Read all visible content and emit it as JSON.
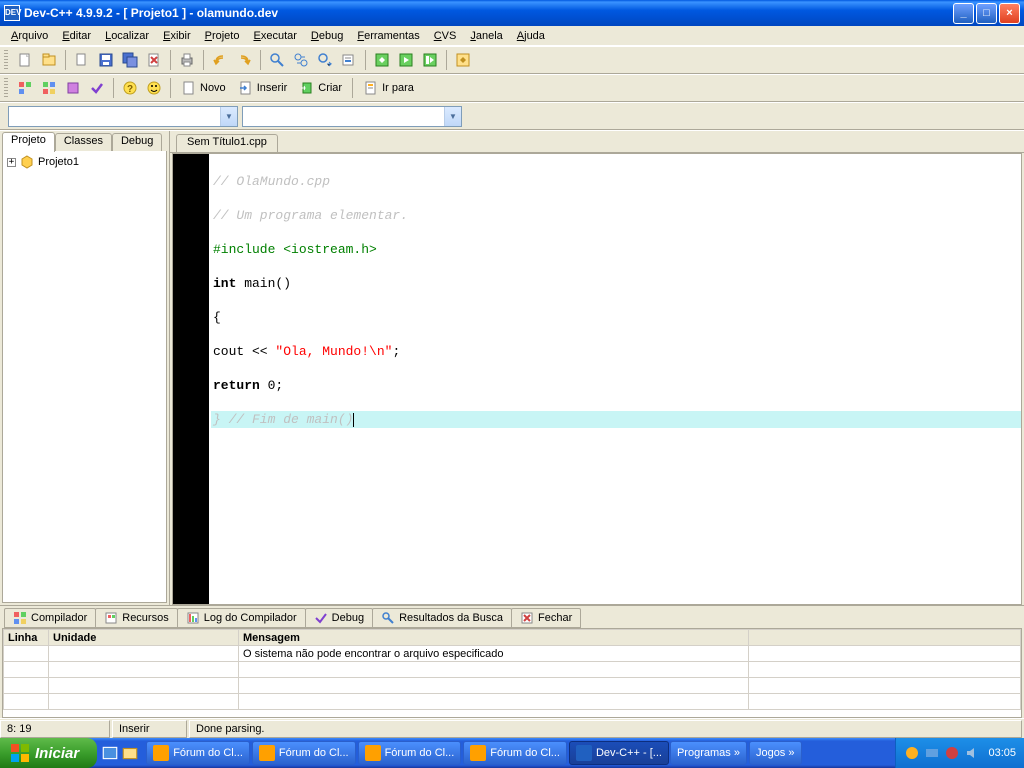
{
  "titlebar": {
    "app_icon_text": "DEV",
    "title": "Dev-C++ 4.9.9.2  -  [ Projeto1 ] - olamundo.dev"
  },
  "menu": {
    "arquivo": "Arquivo",
    "editar": "Editar",
    "localizar": "Localizar",
    "exibir": "Exibir",
    "projeto": "Projeto",
    "executar": "Executar",
    "debug_m": "Debug",
    "ferramentas": "Ferramentas",
    "cvs": "CVS",
    "janela": "Janela",
    "ajuda": "Ajuda"
  },
  "toolbar2": {
    "novo": "Novo",
    "inserir": "Inserir",
    "criar": "Criar",
    "irpara": "Ir para"
  },
  "left_tabs": {
    "projeto": "Projeto",
    "classes": "Classes",
    "debug": "Debug"
  },
  "project_tree": {
    "root": "Projeto1"
  },
  "file_tab": {
    "name": "Sem Título1.cpp"
  },
  "code": {
    "l1": "// OlaMundo.cpp",
    "l2": "// Um programa elementar.",
    "l3a": "#include ",
    "l3b": "<iostream.h>",
    "l4a": "int",
    "l4b": " main()",
    "l5": "{",
    "l6a": "cout << ",
    "l6b": "\"Ola, Mundo!\\n\"",
    "l6c": ";",
    "l7a": "return",
    "l7b": " 0;",
    "l8": "} // Fim de main()"
  },
  "bottom_tabs": {
    "compilador": "Compilador",
    "recursos": "Recursos",
    "log": "Log do Compilador",
    "debug": "Debug",
    "resultados": "Resultados da Busca",
    "fechar": "Fechar"
  },
  "grid": {
    "h_linha": "Linha",
    "h_unidade": "Unidade",
    "h_mensagem": "Mensagem",
    "msg1": "O sistema não pode encontrar o arquivo especificado"
  },
  "status": {
    "pos": "8: 19",
    "mode": "Inserir",
    "parse": "Done parsing."
  },
  "taskbar": {
    "start": "Iniciar",
    "items": [
      {
        "label": "Fórum do Cl..."
      },
      {
        "label": "Fórum do Cl..."
      },
      {
        "label": "Fórum do Cl..."
      },
      {
        "label": "Fórum do Cl..."
      },
      {
        "label": "Dev-C++ - [..."
      }
    ],
    "groups": [
      {
        "label": "Programas"
      },
      {
        "label": "Jogos"
      }
    ],
    "clock": "03:05"
  }
}
